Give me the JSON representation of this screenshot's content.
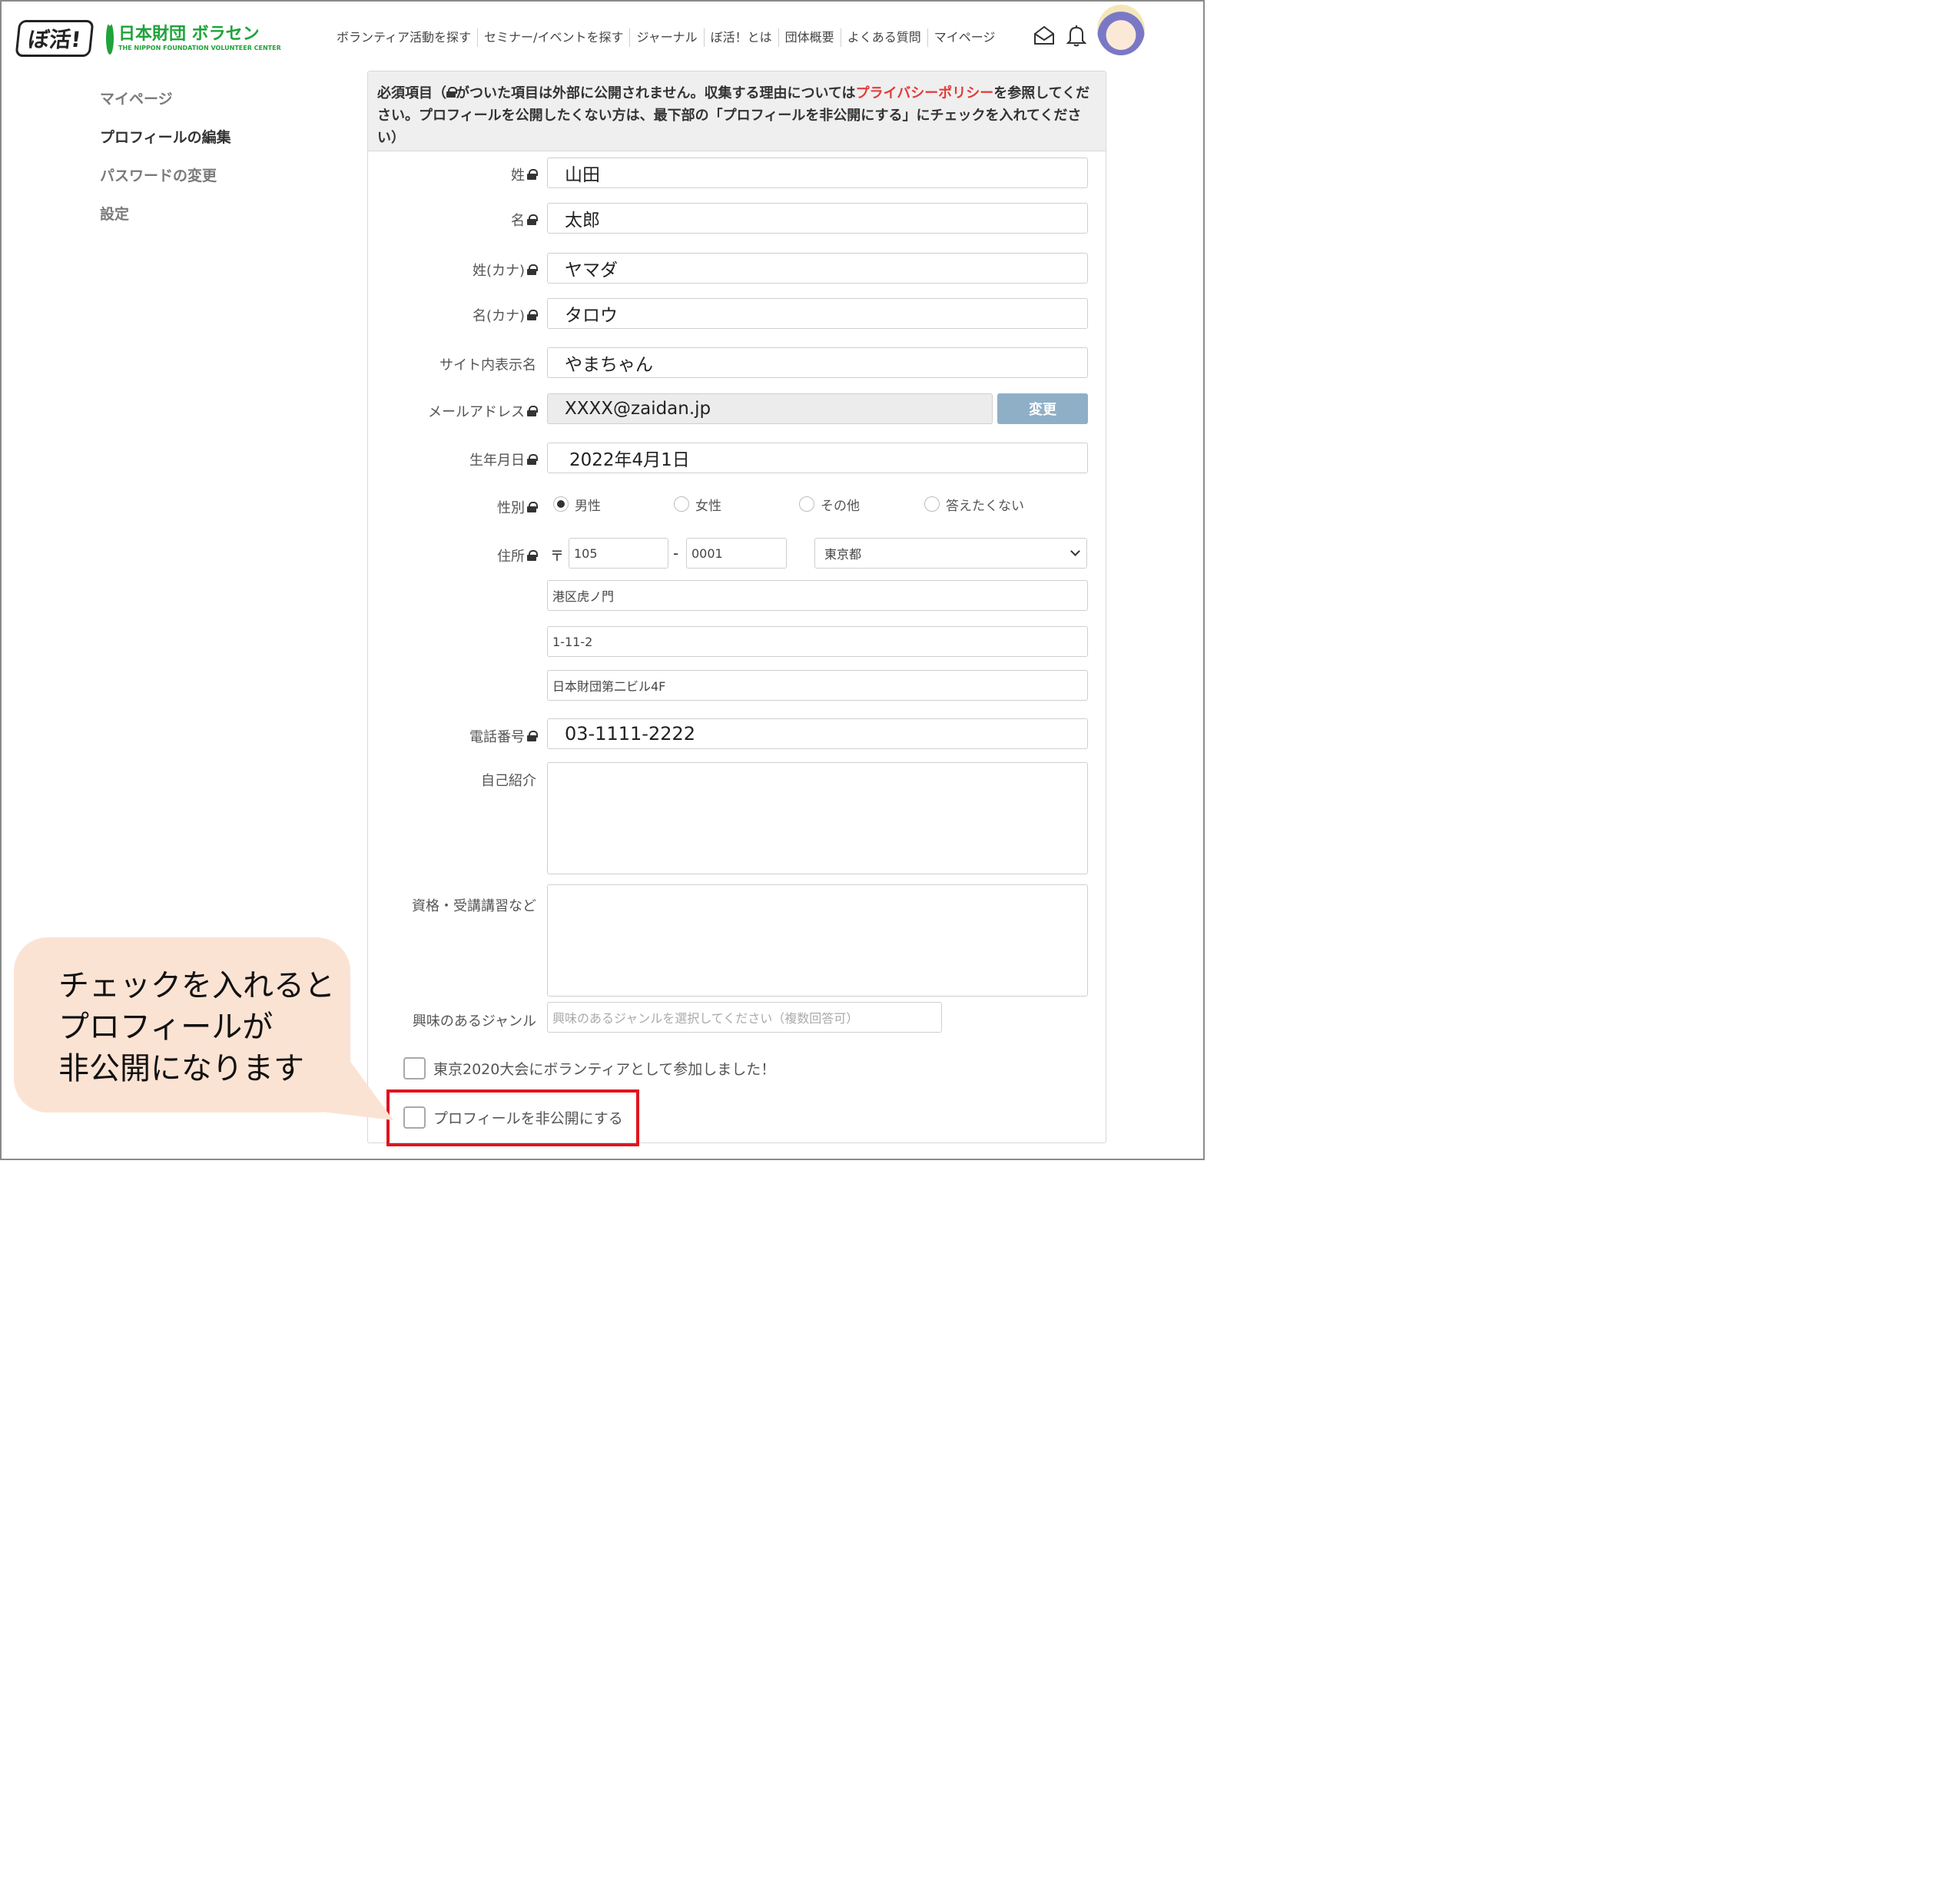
{
  "header": {
    "logo_bokatsu": "ぼ活!",
    "logo_vc_jp": "日本財団 ボラセン",
    "logo_vc_en": "THE NIPPON FOUNDATION VOLUNTEER CENTER",
    "nav": [
      "ボランティア活動を探す",
      "セミナー/イベントを探す",
      "ジャーナル",
      "ぼ活！とは",
      "団体概要",
      "よくある質問",
      "マイページ"
    ],
    "icons": [
      "mail-icon",
      "bell-icon"
    ]
  },
  "sidebar": {
    "items": [
      {
        "label": "マイページ",
        "active": false
      },
      {
        "label": "プロフィールの編集",
        "active": true
      },
      {
        "label": "パスワードの変更",
        "active": false
      },
      {
        "label": "設定",
        "active": false
      }
    ]
  },
  "notice": {
    "part1": "必須項目（",
    "part2": "がついた項目は外部に公開されません。収集する理由については",
    "link": "プライバシーポリシー",
    "part3": "を参照してください。プロフィールを公開したくない方は、最下部の「プロフィールを非公開にする」にチェックを入れてください）"
  },
  "form": {
    "last_name": {
      "label": "姓",
      "value": "山田"
    },
    "first_name": {
      "label": "名",
      "value": "太郎"
    },
    "last_kana": {
      "label": "姓(カナ)",
      "value": "ヤマダ"
    },
    "first_kana": {
      "label": "名(カナ)",
      "value": "タロウ"
    },
    "display_name": {
      "label": "サイト内表示名",
      "value": "やまちゃん"
    },
    "email": {
      "label": "メールアドレス",
      "value": "XXXX@zaidan.jp",
      "button": "変更"
    },
    "birthday": {
      "label": "生年月日",
      "value": "2022年4月1日"
    },
    "gender": {
      "label": "性別",
      "options": [
        "男性",
        "女性",
        "その他",
        "答えたくない"
      ],
      "selected": "男性"
    },
    "address": {
      "label": "住所",
      "zip_mark": "〒",
      "zip1": "105",
      "zip_dash": "-",
      "zip2": "0001",
      "prefecture": "東京都",
      "line1": "港区虎ノ門",
      "line2": "1-11-2",
      "line3": "日本財団第二ビル4F"
    },
    "phone": {
      "label": "電話番号",
      "value": "03-1111-2222"
    },
    "intro": {
      "label": "自己紹介",
      "value": ""
    },
    "qualifications": {
      "label": "資格・受講講習など",
      "value": ""
    },
    "genre": {
      "label": "興味のあるジャンル",
      "placeholder": "興味のあるジャンルを選択してください（複数回答可）"
    },
    "tokyo2020": {
      "label": "東京2020大会にボランティアとして参加しました！",
      "checked": false
    },
    "private": {
      "label": "プロフィールを非公開にする",
      "checked": false
    }
  },
  "callout": {
    "line1": "チェックを入れると",
    "line2": "プロフィールが",
    "line3": "非公開になります"
  },
  "colors": {
    "brand_green": "#1fa33a",
    "link_red": "#e33a3a",
    "highlight_red": "#e0141e",
    "callout_bg": "#fbe3d4",
    "change_button": "#8fafc7"
  }
}
